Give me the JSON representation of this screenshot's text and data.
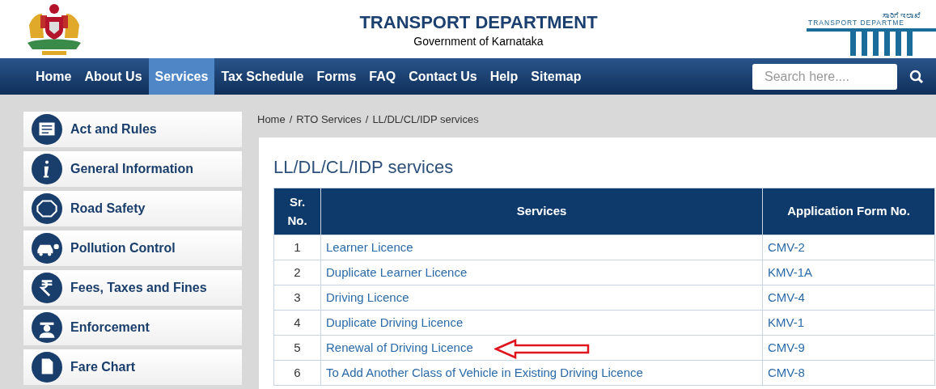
{
  "header": {
    "title": "TRANSPORT DEPARTMENT",
    "subtitle": "Government of Karnataka",
    "logo_text": "ಸಾರಿಗೆ ಇಲಾಖೆ",
    "logo_caption": "TRANSPORT DEPARTME"
  },
  "nav": [
    {
      "label": "Home",
      "selected": false
    },
    {
      "label": "About Us",
      "selected": false
    },
    {
      "label": "Services",
      "selected": true
    },
    {
      "label": "Tax Schedule",
      "selected": false
    },
    {
      "label": "Forms",
      "selected": false
    },
    {
      "label": "FAQ",
      "selected": false
    },
    {
      "label": "Contact Us",
      "selected": false
    },
    {
      "label": "Help",
      "selected": false
    },
    {
      "label": "Sitemap",
      "selected": false
    }
  ],
  "search": {
    "placeholder": "Search here...."
  },
  "sidebar": {
    "items": [
      {
        "label": "Act and Rules",
        "kind": "rule"
      },
      {
        "label": "General Information",
        "kind": "info"
      },
      {
        "label": "Road Safety",
        "kind": "safe"
      },
      {
        "label": "Pollution Control",
        "kind": "car"
      },
      {
        "label": "Fees, Taxes and Fines",
        "kind": "rupee"
      },
      {
        "label": "Enforcement",
        "kind": "officer"
      },
      {
        "label": "Fare Chart",
        "kind": "document"
      }
    ]
  },
  "breadcrumb": {
    "separator": "/",
    "items": [
      "Home",
      "RTO Services",
      "LL/DL/CL/IDP services"
    ]
  },
  "page_title": "LL/DL/CL/IDP services",
  "table": {
    "columns": [
      "Sr. No.",
      "Services",
      "Application Form No."
    ],
    "rows": [
      [
        "1",
        "Learner Licence",
        "CMV-2"
      ],
      [
        "2",
        "Duplicate Learner Licence",
        "KMV-1A"
      ],
      [
        "3",
        "Driving Licence",
        "CMV-4"
      ],
      [
        "4",
        "Duplicate Driving Licence",
        "KMV-1"
      ],
      [
        "5",
        "Renewal of Driving Licence",
        "CMV-9"
      ],
      [
        "6",
        "To Add Another Class of Vehicle in Existing Driving Licence",
        "CMV-8"
      ]
    ]
  }
}
